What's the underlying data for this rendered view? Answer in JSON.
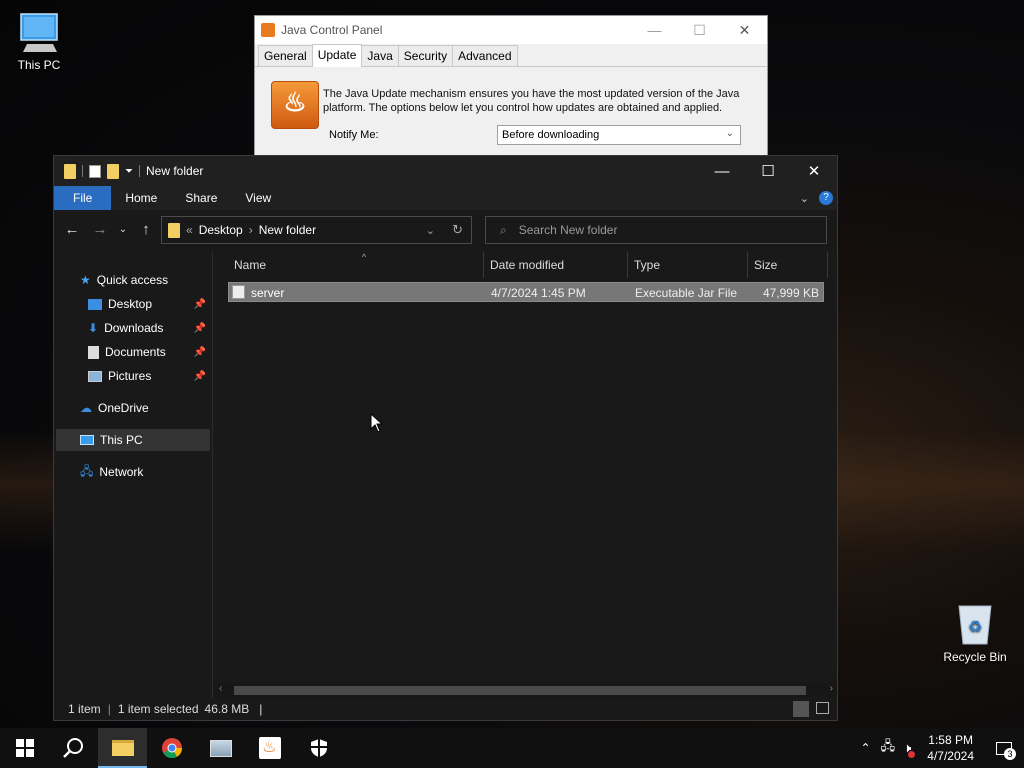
{
  "desktop": {
    "icons": {
      "this_pc": "This PC",
      "recycle_bin": "Recycle Bin"
    }
  },
  "java_panel": {
    "title": "Java Control Panel",
    "tabs": [
      "General",
      "Update",
      "Java",
      "Security",
      "Advanced"
    ],
    "active_tab": "Update",
    "description": "The Java Update mechanism ensures you have the most updated version of the Java platform. The options below let you control how updates are obtained and applied.",
    "notify_label": "Notify Me:",
    "notify_value": "Before downloading"
  },
  "explorer": {
    "title": "New folder",
    "ribbon_tabs": {
      "file": "File",
      "home": "Home",
      "share": "Share",
      "view": "View"
    },
    "address": {
      "prefix": "«",
      "crumb1": "Desktop",
      "crumb2": "New folder"
    },
    "search_placeholder": "Search New folder",
    "nav": {
      "quick_access": "Quick access",
      "desktop": "Desktop",
      "downloads": "Downloads",
      "documents": "Documents",
      "pictures": "Pictures",
      "onedrive": "OneDrive",
      "this_pc": "This PC",
      "network": "Network"
    },
    "columns": {
      "name": "Name",
      "date": "Date modified",
      "type": "Type",
      "size": "Size"
    },
    "files": [
      {
        "name": "server",
        "date": "4/7/2024 1:45 PM",
        "type": "Executable Jar File",
        "size": "47,999 KB"
      }
    ],
    "status": {
      "count": "1 item",
      "selected": "1 item selected",
      "size": "46.8 MB"
    }
  },
  "taskbar": {
    "time": "1:58 PM",
    "date": "4/7/2024",
    "notification_count": "3"
  },
  "colors": {
    "accent": "#2a6cbf",
    "folder": "#f3cf63",
    "selection": "#777777"
  }
}
